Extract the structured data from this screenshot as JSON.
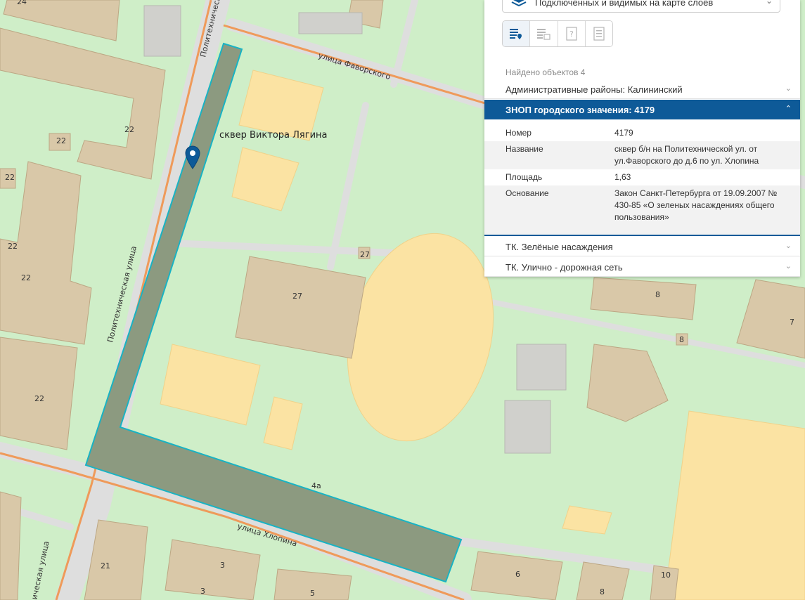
{
  "map": {
    "streets": {
      "politekhnicheskaya_top": "Политехническа",
      "politekhnicheskaya_mid": "Политехническая улица",
      "politekhnicheskaya_bottom": "ическая улица",
      "favorskogo": "улица Фаворского",
      "khlopina": "улица Хлопина"
    },
    "park_label": "сквер Виктора Лягина",
    "house_numbers": [
      "24",
      "22",
      "22",
      "22",
      "22",
      "22",
      "22",
      "27",
      "27",
      "4а",
      "21",
      "3",
      "3",
      "5",
      "6",
      "8",
      "10",
      "8",
      "8",
      "7"
    ],
    "colors": {
      "background": "#cfeec8",
      "building": "#d9c8a8",
      "sports": "#fbe3a3",
      "road": "#dedede",
      "main_road": "#ef9a5a",
      "selected_fill": "#8c9a80",
      "selected_outline": "#18b3c4",
      "pin": "#0e5a98"
    }
  },
  "panel": {
    "layer_select": {
      "text": "Подключённых и видимых на карте слоёв",
      "icon": "layers-icon"
    },
    "toolbar": {
      "buttons": [
        {
          "icon": "list-pin-icon",
          "active": true
        },
        {
          "icon": "list-table-icon",
          "active": false
        },
        {
          "icon": "question-doc-icon",
          "active": false
        },
        {
          "icon": "document-icon",
          "active": false
        }
      ]
    },
    "found_text": "Найдено объектов 4",
    "accordion": [
      {
        "label": "Административные районы: Калининский",
        "open": false
      },
      {
        "label": "ЗНОП городского значения: 4179",
        "open": true
      },
      {
        "label": "ТК. Зелёные насаждения",
        "open": false
      },
      {
        "label": "ТК. Улично - дорожная сеть",
        "open": false
      }
    ],
    "attributes": [
      {
        "key": "Номер",
        "value": "4179"
      },
      {
        "key": "Название",
        "value": "сквер б/н на Политехнической ул. от ул.Фаворского до д.6 по ул. Хлопина"
      },
      {
        "key": "Площадь",
        "value": "1,63"
      },
      {
        "key": "Основание",
        "value": "Закон Санкт-Петербурга от 19.09.2007 № 430-85 «О зеленых насаждениях общего пользования»"
      }
    ]
  }
}
